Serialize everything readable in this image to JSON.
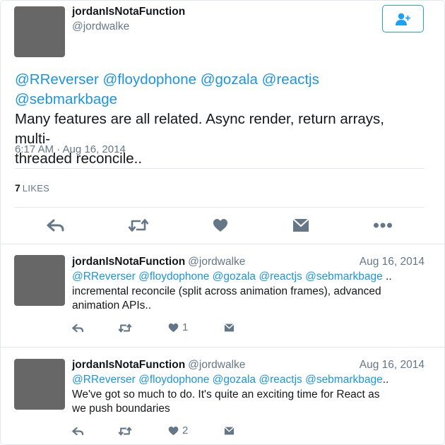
{
  "main": {
    "author_name": "jordanIsNotaFunction",
    "author_handle": "@jordwalke",
    "mentions": [
      "@RReverser",
      "@floydophone",
      "@gozala",
      "@reactjs",
      "@sebmarkbage"
    ],
    "text": "Many features are all related. Async render, return arrays, multi-threaded reconcile..",
    "text_line1": "Many features are all related. Async render, return arrays, multi-",
    "text_line2": "threaded reconcile..",
    "timestamp": "6:17 AM · Aug 16, 2014",
    "likes_count": "7",
    "likes_label": "LIKES",
    "actions": [
      "reply-icon",
      "retweet-icon",
      "heart-icon",
      "direct-message-icon",
      "more-icon"
    ]
  },
  "replies": [
    {
      "author_name": "jordanIsNotaFunction",
      "author_handle": "@jordwalke",
      "date": "Aug 16, 2014",
      "mentions": [
        "@RReverser",
        "@floydophone",
        "@gozala",
        "@reactjs",
        "@sebmarkbage"
      ],
      "suffix": " ..",
      "line2": "incremental reconcile (split across animation frames), advanced",
      "line3": "animation APIs..",
      "like_count": "1"
    },
    {
      "author_name": "jordanIsNotaFunction",
      "author_handle": "@jordwalke",
      "date": "Aug 16, 2014",
      "mentions": [
        "@RReverser",
        "@floydophone",
        "@gozala",
        "@reactjs",
        "@sebmarkbage"
      ],
      "suffix": "..",
      "line2": "We've got so much to do. It's quite an exciting time for React as",
      "line3": "we push boundaries",
      "like_count": "2"
    }
  ],
  "colors": {
    "link": "#1b95e0",
    "follow_border": "#1da1f2",
    "secondary_text": "#657786",
    "icon": "#657786",
    "avatar": "#676767",
    "divider": "#e1e8ed"
  }
}
